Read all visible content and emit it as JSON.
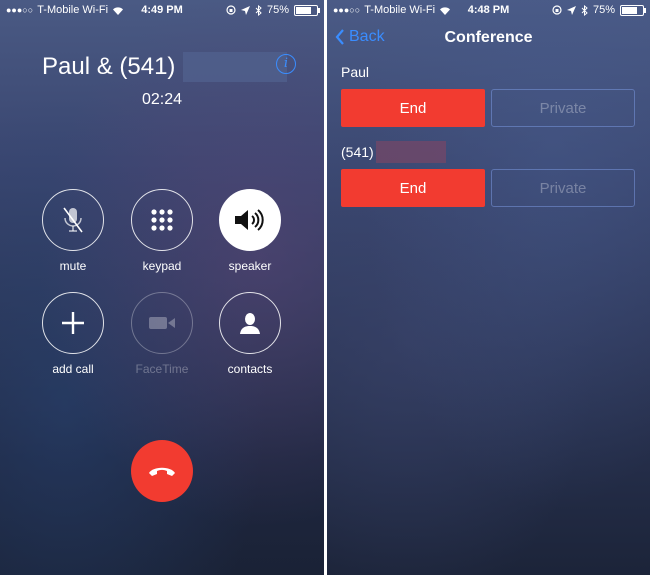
{
  "left": {
    "status": {
      "carrier": "T-Mobile Wi-Fi",
      "time": "4:49 PM",
      "battery": "75%"
    },
    "caller": {
      "name": "Paul & (541)"
    },
    "call_timer": "02:24",
    "controls": [
      {
        "label": "mute",
        "icon": "muted-mic-icon"
      },
      {
        "label": "keypad",
        "icon": "keypad-icon"
      },
      {
        "label": "speaker",
        "icon": "speaker-icon",
        "active": true
      },
      {
        "label": "add call",
        "icon": "plus-icon"
      },
      {
        "label": "FaceTime",
        "icon": "video-camera-icon",
        "disabled": true
      },
      {
        "label": "contacts",
        "icon": "person-icon"
      }
    ],
    "end_call_icon": "phone-hangup-icon",
    "colors": {
      "end_red": "#f23b30",
      "link_blue": "#3a8dff"
    }
  },
  "right": {
    "status": {
      "carrier": "T-Mobile Wi-Fi",
      "time": "4:48 PM",
      "battery": "75%"
    },
    "nav": {
      "back_label": "Back",
      "title": "Conference"
    },
    "participants": [
      {
        "name": "Paul",
        "end_label": "End",
        "private_label": "Private"
      },
      {
        "name": "(541)",
        "end_label": "End",
        "private_label": "Private"
      }
    ]
  }
}
